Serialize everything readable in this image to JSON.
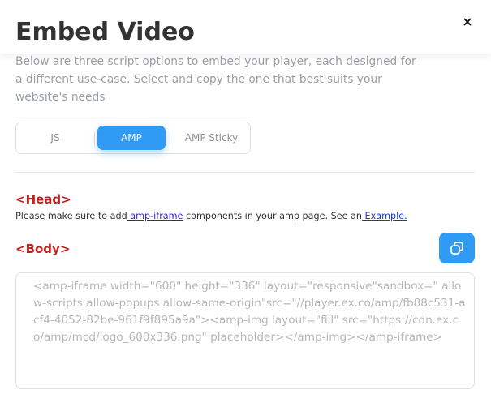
{
  "modal": {
    "title": "Embed Video",
    "close_label": "×",
    "description": "Below are three script options to embed your player, each designed for a different use-case. Select and copy the one that best suits your website's needs"
  },
  "tabs": [
    {
      "label": "JS",
      "active": false
    },
    {
      "label": "AMP",
      "active": true
    },
    {
      "label": "AMP Sticky",
      "active": false
    }
  ],
  "head_section": {
    "label": "<Head>",
    "note_prefix": "Please make sure to add",
    "link_amp_iframe": " amp-iframe",
    "note_middle": " components in your amp page. See an",
    "link_example": " Example."
  },
  "body_section": {
    "label": "<Body>",
    "copy_icon": "copy-icon",
    "code": "<amp-iframe width=\"600\" height=\"336\" layout=\"responsive\"sandbox=\" allow-scripts allow-popups allow-same-origin\"src=\"//player.ex.co/amp/fb88c531-acf4-4052-82be-961f9f895a9a\"><amp-img layout=\"fill\" src=\"https://cdn.ex.co/amp/mcd/logo_600x336.png\" placeholder></amp-img></amp-iframe>"
  },
  "colors": {
    "accent": "#2f9bf5",
    "section_label": "#c0201f",
    "link": "#3b1cc9"
  }
}
